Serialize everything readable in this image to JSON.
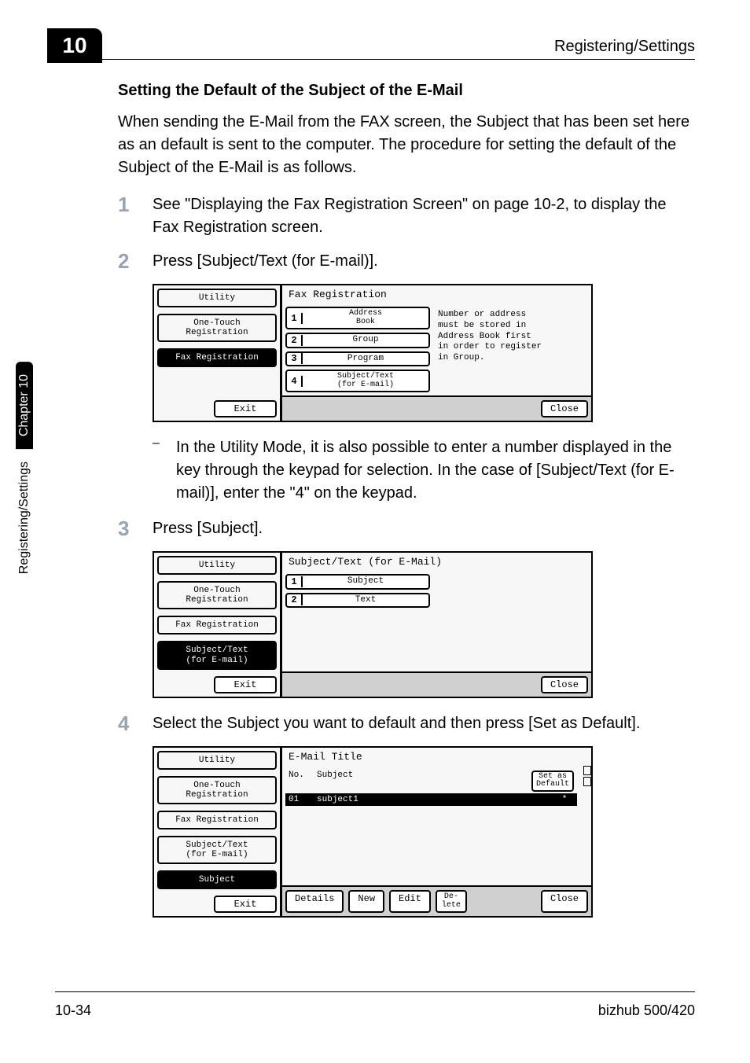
{
  "chapter_tab": "10",
  "header_right": "Registering/Settings",
  "side_tab_black": "Chapter 10",
  "side_tab_white": "Registering/Settings",
  "footer_left": "10-34",
  "footer_right": "bizhub 500/420",
  "section_title": "Setting the Default of the Subject of the E-Mail",
  "intro": "When sending the E-Mail from the FAX screen, the Subject that has been set here as an default is sent to the computer. The procedure for setting the default of the Subject of the E-Mail is as follows.",
  "steps": {
    "s1_num": "1",
    "s1_text": "See \"Displaying the Fax Registration Screen\" on page 10-2, to display the Fax Registration screen.",
    "s2_num": "2",
    "s2_text": "Press [Subject/Text (for E-mail)].",
    "s2_bullet": "In the Utility Mode, it is also possible to enter a number displayed in the key through the keypad for selection. In the case of [Subject/Text (for E-mail)], enter the \"4\" on the keypad.",
    "s3_num": "3",
    "s3_text": "Press [Subject].",
    "s4_num": "4",
    "s4_text": "Select the Subject you want to default and then press [Set as Default]."
  },
  "bullet_dash": "–",
  "lcd1": {
    "crumb_utility": "Utility",
    "crumb_onetouch": "One-Touch\nRegistration",
    "crumb_faxreg": "Fax Registration",
    "exit": "Exit",
    "title": "Fax Registration",
    "opt1_n": "1",
    "opt1_t": "Address\nBook",
    "opt2_n": "2",
    "opt2_t": "Group",
    "opt3_n": "3",
    "opt3_t": "Program",
    "opt4_n": "4",
    "opt4_t": "Subject/Text\n(for E-mail)",
    "note": "Number or address\nmust be stored in\nAddress Book first\nin order to register\nin Group.",
    "close": "Close"
  },
  "lcd2": {
    "crumb_utility": "Utility",
    "crumb_onetouch": "One-Touch\nRegistration",
    "crumb_faxreg": "Fax Registration",
    "crumb_subjtext": "Subject/Text\n(for E-mail)",
    "exit": "Exit",
    "title": "Subject/Text (for E-Mail)",
    "opt1_n": "1",
    "opt1_t": "Subject",
    "opt2_n": "2",
    "opt2_t": "Text",
    "close": "Close"
  },
  "lcd3": {
    "crumb_utility": "Utility",
    "crumb_onetouch": "One-Touch\nRegistration",
    "crumb_faxreg": "Fax Registration",
    "crumb_subjtext": "Subject/Text\n(for E-mail)",
    "crumb_subject": "Subject",
    "exit": "Exit",
    "title": "E-Mail Title",
    "col_no": "No.",
    "col_subject": "Subject",
    "set_as_default": "Set as\nDefault",
    "row1_no": "01",
    "row1_subject": "subject1",
    "row1_mark": "*",
    "btn_details": "Details",
    "btn_new": "New",
    "btn_edit": "Edit",
    "btn_delete": "De-\nlete",
    "btn_close": "Close"
  }
}
